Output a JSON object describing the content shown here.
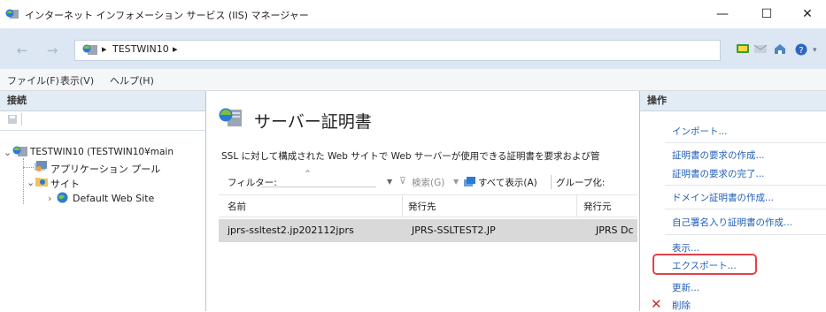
{
  "window": {
    "title": "インターネット インフォメーション サービス (IIS) マネージャー",
    "minimize_glyph": "—",
    "maximize_glyph": "☐",
    "close_glyph": "✕"
  },
  "address": {
    "back_glyph": "←",
    "forward_glyph": "→",
    "path_item": "TESTWIN10",
    "separator": "▸"
  },
  "menu": [
    "ファイル(F)",
    "表示(V)",
    "ヘルプ(H)"
  ],
  "left_pane": {
    "header": "接続",
    "tree": [
      {
        "label": "TESTWIN10 (TESTWIN10¥main"
      },
      {
        "label": "アプリケーション プール"
      },
      {
        "label": "サイト"
      },
      {
        "label": "Default Web Site"
      }
    ]
  },
  "center": {
    "title": "サーバー証明書",
    "description": "SSL に対して構成された Web サイトで Web サーバーが使用できる証明書を要求および管",
    "filter_label": "フィルター:",
    "search_label": "検索(G)",
    "show_all_label": "すべて表示(A)",
    "group_label": "グループ化:",
    "columns": [
      "名前",
      "発行先",
      "発行元"
    ],
    "rows": [
      {
        "name": "jprs-ssltest2.jp202112jprs",
        "issued_to": "JPRS-SSLTEST2.JP",
        "issued_by": "JPRS Dc"
      }
    ]
  },
  "right_pane": {
    "header": "操作",
    "actions": [
      "インポート...",
      "証明書の要求の作成...",
      "証明書の要求の完了...",
      "ドメイン証明書の作成...",
      "自己署名入り証明書の作成...",
      "表示...",
      "エクスポート...",
      "更新...",
      "削除"
    ]
  },
  "colors": {
    "accent_link": "#2360b8",
    "highlight": "#e0424a",
    "selected_row": "#d9d9d9",
    "pane_header": "#e3ebf4",
    "address_bar": "#dce7f3"
  }
}
